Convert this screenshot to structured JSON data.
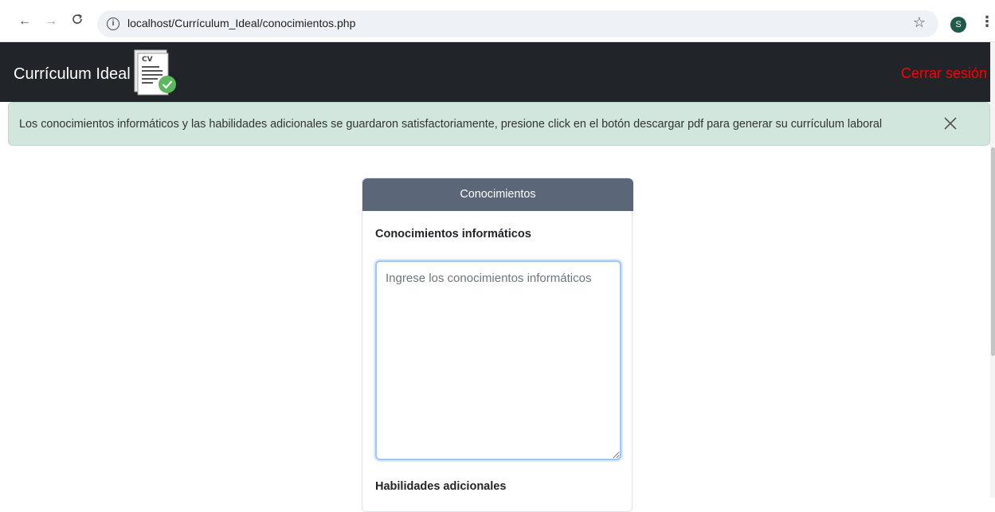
{
  "browser": {
    "url": "localhost/Currículum_Ideal/conocimientos.php",
    "profile_initial": "S"
  },
  "navbar": {
    "brand": "Currículum Ideal",
    "logo_text": "CV",
    "logout": "Cerrar sesión"
  },
  "alert": {
    "message": "Los conocimientos informáticos y las habilidades adicionales se guardaron satisfactoriamente, presione click en el botón descargar pdf para generar su currículum laboral"
  },
  "card": {
    "header": "Conocimientos",
    "field1_label": "Conocimientos informáticos",
    "field1_placeholder": "Ingrese los conocimientos informáticos",
    "field1_value": "",
    "field2_label": "Habilidades adicionales"
  },
  "colors": {
    "navbar_bg": "#212529",
    "alert_bg": "#d1e7dd",
    "card_header_bg": "#5b6678",
    "logout": "#ff0000"
  },
  "icons": [
    "back-arrow-icon",
    "forward-arrow-icon",
    "reload-icon",
    "info-icon",
    "star-icon",
    "kebab-menu-icon",
    "close-icon",
    "cv-document-icon"
  ]
}
